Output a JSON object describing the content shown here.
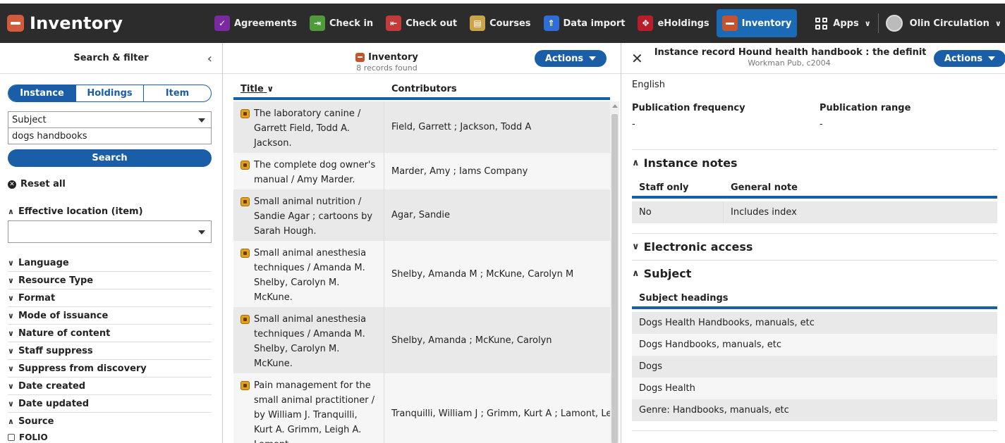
{
  "header": {
    "brand_title": "Inventory",
    "apps": [
      {
        "label": "Agreements",
        "color": "#7a2aa0",
        "active": false
      },
      {
        "label": "Check in",
        "color": "#4f9a3a",
        "active": false
      },
      {
        "label": "Check out",
        "color": "#c43a3a",
        "active": false
      },
      {
        "label": "Courses",
        "color": "#caa44a",
        "active": false
      },
      {
        "label": "Data import",
        "color": "#2e6ed6",
        "active": false
      },
      {
        "label": "eHoldings",
        "color": "#b81e2a",
        "active": false
      },
      {
        "label": "Inventory",
        "color": "#c6532f",
        "active": true
      }
    ],
    "apps_menu_label": "Apps",
    "user_label": "Olin Circulation"
  },
  "filter_pane": {
    "title": "Search & filter",
    "segments": [
      "Instance",
      "Holdings",
      "Item"
    ],
    "selected_segment": "Instance",
    "search_field_option": "Subject",
    "search_value": "dogs handbooks",
    "search_button": "Search",
    "reset_label": "Reset all",
    "effective_location_label": "Effective location (item)",
    "facets": [
      "Language",
      "Resource Type",
      "Format",
      "Mode of issuance",
      "Nature of content",
      "Staff suppress",
      "Suppress from discovery",
      "Date created",
      "Date updated"
    ],
    "source_label": "Source",
    "source_option": "FOLIO"
  },
  "results_pane": {
    "title": "Inventory",
    "subtitle": "8 records found",
    "actions_label": "Actions",
    "columns": {
      "title": "Title",
      "contributors": "Contributors"
    },
    "rows": [
      {
        "title": "The laboratory canine / Garrett Field, Todd A. Jackson.",
        "contributors": "Field, Garrett ; Jackson, Todd A"
      },
      {
        "title": "The complete dog owner's manual / Amy Marder.",
        "contributors": "Marder, Amy ; Iams Company"
      },
      {
        "title": "Small animal nutrition / Sandie Agar ; cartoons by Sarah Hough.",
        "contributors": "Agar, Sandie"
      },
      {
        "title": "Small animal anesthesia techniques / Amanda M. Shelby, Carolyn M. McKune.",
        "contributors": "Shelby, Amanda M ; McKune, Carolyn M"
      },
      {
        "title": "Small animal anesthesia techniques / Amanda M. Shelby, Carolyn M. McKune.",
        "contributors": "Shelby, Amanda ; McKune, Carolyn"
      },
      {
        "title": "Pain management for the small animal practitioner / by William J. Tranquilli, Kurt A. Grimm, Leigh A. Lamont.",
        "contributors": "Tranquilli, William J ; Grimm, Kurt A ; Lamont, Le"
      }
    ]
  },
  "detail_pane": {
    "title": "Instance record Hound health handbook : the definit...",
    "subtitle": "Workman Pub, c2004",
    "actions_label": "Actions",
    "language_value": "English",
    "publication_frequency_label": "Publication frequency",
    "publication_frequency_value": "-",
    "publication_range_label": "Publication range",
    "publication_range_value": "-",
    "instance_notes_heading": "Instance notes",
    "notes_columns": {
      "staff_only": "Staff only",
      "general_note": "General note"
    },
    "notes_row": {
      "staff_only": "No",
      "general_note": "Includes index"
    },
    "electronic_access_heading": "Electronic access",
    "subject_heading": "Subject",
    "subject_column": "Subject headings",
    "subjects": [
      "Dogs Health Handbooks, manuals, etc",
      "Dogs Handbooks, manuals, etc",
      "Dogs",
      "Dogs Health",
      "Genre: Handbooks, manuals, etc"
    ]
  }
}
